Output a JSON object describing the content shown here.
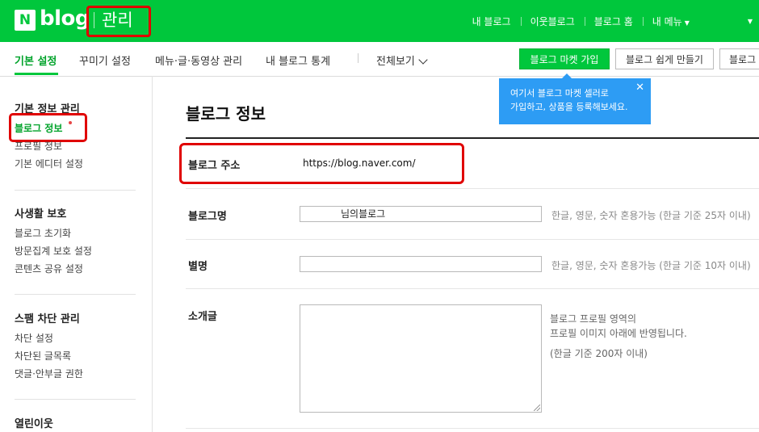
{
  "header": {
    "logo_letter": "N",
    "logo_text": "blog",
    "section": "관리",
    "links": [
      "내 블로그",
      "이웃블로그",
      "블로그 홈",
      "내 메뉴"
    ],
    "more_icon": "caret-down-icon"
  },
  "tabs": [
    {
      "label": "기본 설정",
      "active": true
    },
    {
      "label": "꾸미기 설정",
      "active": false
    },
    {
      "label": "메뉴·글·동영상 관리",
      "active": false
    },
    {
      "label": "내 블로그 통계",
      "active": false
    }
  ],
  "view_all": "전체보기",
  "buttons": {
    "market": "블로그 마켓 가입",
    "easy": "블로그 쉽게 만들기",
    "more": "블로그"
  },
  "tooltip": {
    "line1": "여기서 블로그 마켓 셀러로",
    "line2": "가입하고, 상품을 등록해보세요.",
    "close_icon": "close-icon"
  },
  "sidebar": {
    "groups": [
      {
        "title": "기본 정보 관리",
        "items": [
          "블로그 정보",
          "프로필 정보",
          "기본 에디터 설정"
        ]
      },
      {
        "title": "사생활 보호",
        "items": [
          "블로그 초기화",
          "방문집계 보호 설정",
          "콘텐츠 공유 설정"
        ]
      },
      {
        "title": "스팸 차단 관리",
        "items": [
          "차단 설정",
          "차단된 글목록",
          "댓글·안부글 권한"
        ]
      },
      {
        "title": "열린이웃",
        "items": []
      }
    ]
  },
  "main": {
    "title": "블로그 정보",
    "address": {
      "label": "블로그 주소",
      "value": "https://blog.naver.com/"
    },
    "name": {
      "label": "블로그명",
      "value": "님의블로그",
      "hint": "한글, 영문, 숫자 혼용가능 (한글 기준 25자 이내)"
    },
    "nickname": {
      "label": "별명",
      "value": "",
      "hint": "한글, 영문, 숫자 혼용가능 (한글 기준 10자 이내)"
    },
    "intro": {
      "label": "소개글",
      "hint_line1": "블로그 프로필 영역의",
      "hint_line2": "프로필 이미지 아래에 반영됩니다.",
      "hint_line3": "(한글 기준 200자 이내)"
    }
  },
  "colors": {
    "brand_green": "#00c73c",
    "tooltip_blue": "#2d9cf4",
    "highlight_red": "#e00000"
  }
}
